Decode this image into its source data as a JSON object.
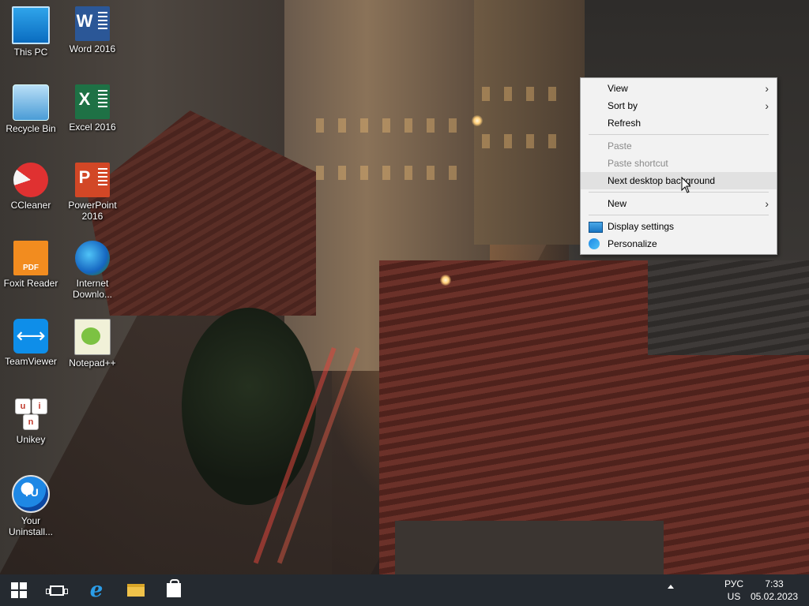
{
  "desktop": {
    "icons": [
      {
        "label": "This PC",
        "icon": "this-pc-icon"
      },
      {
        "label": "Word 2016",
        "icon": "word-icon"
      },
      {
        "label": "Recycle Bin",
        "icon": "recycle-bin-icon"
      },
      {
        "label": "Excel 2016",
        "icon": "excel-icon"
      },
      {
        "label": "CCleaner",
        "icon": "ccleaner-icon"
      },
      {
        "label": "PowerPoint 2016",
        "icon": "powerpoint-icon"
      },
      {
        "label": "Foxit Reader",
        "icon": "foxit-reader-icon"
      },
      {
        "label": "Internet Downlo...",
        "icon": "internet-download-manager-icon"
      },
      {
        "label": "TeamViewer",
        "icon": "teamviewer-icon"
      },
      {
        "label": "Notepad++",
        "icon": "notepad-plus-plus-icon"
      },
      {
        "label": "Unikey",
        "icon": "unikey-icon"
      },
      {
        "label": "Your Uninstall...",
        "icon": "your-uninstaller-icon"
      }
    ],
    "icon_glyphs": {
      "word": "W",
      "excel": "X",
      "ppt": "P",
      "foxit": "PDF",
      "yu": "YU",
      "unikey": [
        "u",
        "i",
        "n"
      ]
    }
  },
  "context_menu": {
    "items": [
      {
        "label": "View",
        "submenu": true,
        "enabled": true
      },
      {
        "label": "Sort by",
        "submenu": true,
        "enabled": true
      },
      {
        "label": "Refresh",
        "submenu": false,
        "enabled": true
      },
      {
        "label": "Paste",
        "submenu": false,
        "enabled": false
      },
      {
        "label": "Paste shortcut",
        "submenu": false,
        "enabled": false
      },
      {
        "label": "Next desktop background",
        "submenu": false,
        "enabled": true,
        "hovered": true
      },
      {
        "label": "New",
        "submenu": true,
        "enabled": true
      },
      {
        "label": "Display settings",
        "submenu": false,
        "enabled": true,
        "icon": "display-settings-icon"
      },
      {
        "label": "Personalize",
        "submenu": false,
        "enabled": true,
        "icon": "personalize-icon"
      }
    ],
    "submenu_arrow": "›"
  },
  "taskbar": {
    "buttons": [
      "start-button",
      "task-view-button",
      "internet-explorer-button",
      "file-explorer-button",
      "store-button"
    ],
    "language": {
      "top": "РУС",
      "bottom": "US"
    },
    "clock": {
      "time": "7:33",
      "date": "05.02.2023"
    }
  },
  "colors": {
    "taskbar": "#12181e",
    "menu_bg": "#f2f2f2",
    "menu_hover": "#e1e1e1",
    "disabled_text": "#8a8a8a"
  }
}
